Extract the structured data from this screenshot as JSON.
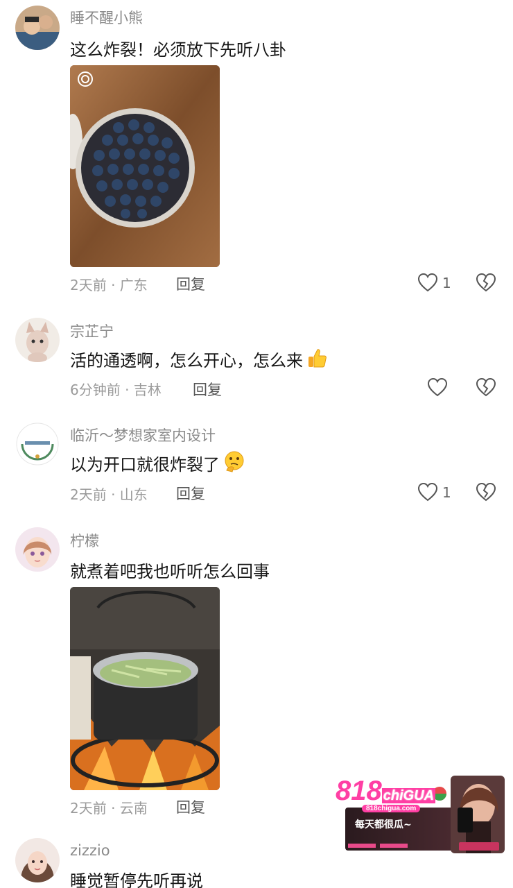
{
  "comments": [
    {
      "username": "睡不醒小熊",
      "text": "这么炸裂！必须放下先听八卦",
      "meta": "2天前 · 广东",
      "reply": "回复",
      "likes": "1"
    },
    {
      "username": "宗芷宁",
      "text": "活的通透啊，怎么开心，怎么来",
      "meta": "6分钟前 · 吉林",
      "reply": "回复",
      "likes": ""
    },
    {
      "username": "临沂～梦想家室内设计",
      "text": "以为开口就很炸裂了",
      "meta": "2天前 · 山东",
      "reply": "回复",
      "likes": "1"
    },
    {
      "username": "柠檬",
      "text": "就煮着吧我也听听怎么回事",
      "meta": "2天前 · 云南",
      "reply": "回复",
      "likes": ""
    },
    {
      "username": "zizzio",
      "text": "睡觉暂停先听再说"
    }
  ],
  "ad": {
    "logo": "818",
    "logo_suffix": "chiGUA",
    "url": "818chigua.com",
    "slogan": "每天都很瓜~"
  },
  "colors": {
    "meta_text": "#9a9a9a",
    "username_text": "#8a8a8a",
    "ad_pink": "#ff3fa4"
  }
}
